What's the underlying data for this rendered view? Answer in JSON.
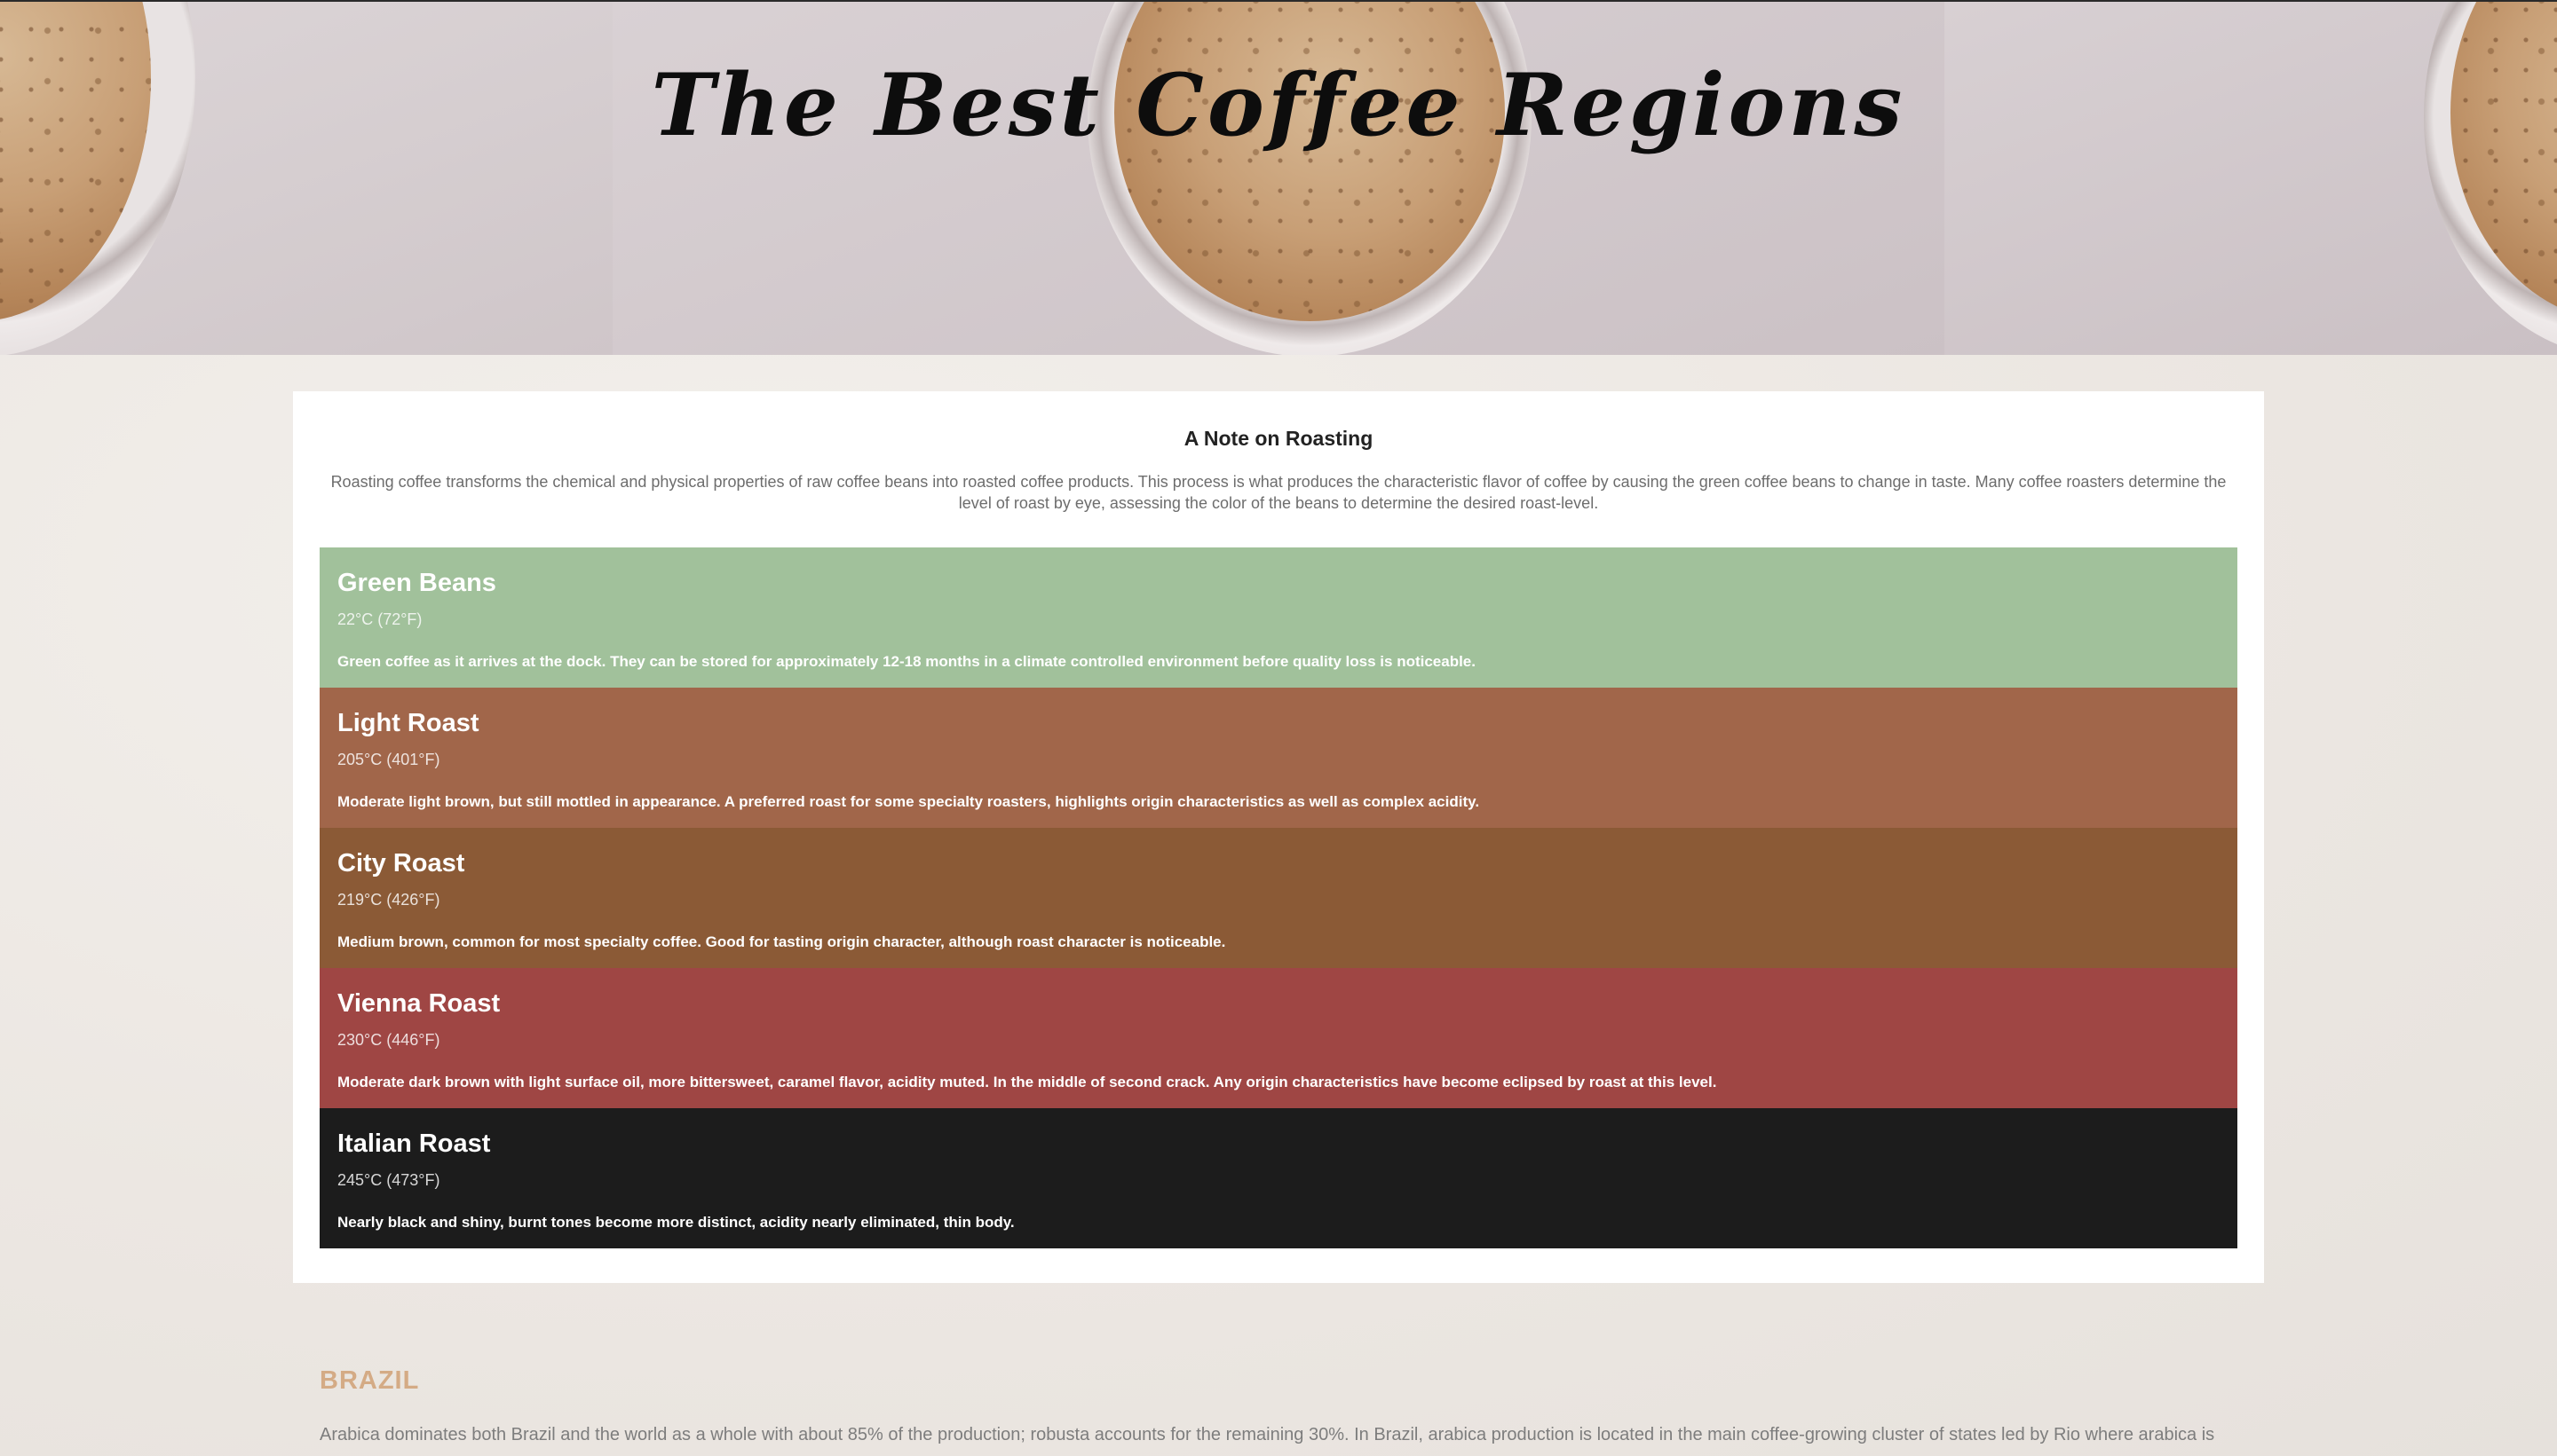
{
  "hero": {
    "title": "The Best Coffee Regions"
  },
  "roasting": {
    "heading": "A Note on Roasting",
    "intro": "Roasting coffee transforms the chemical and physical properties of raw coffee beans into roasted coffee products. This process is what produces the characteristic flavor of coffee by causing the green coffee beans to change in taste. Many coffee roasters determine the level of roast by eye, assessing the color of the beans to determine the desired roast-level.",
    "levels": [
      {
        "name": "Green Beans",
        "temp": "22°C (72°F)",
        "desc": "Green coffee as it arrives at the dock. They can be stored for approximately 12-18 months in a climate controlled environment before quality loss is noticeable.",
        "color": "#a1c19b"
      },
      {
        "name": "Light Roast",
        "temp": "205°C (401°F)",
        "desc": "Moderate light brown, but still mottled in appearance. A preferred roast for some specialty roasters, highlights origin characteristics as well as complex acidity.",
        "color": "#a1664a"
      },
      {
        "name": "City Roast",
        "temp": "219°C (426°F)",
        "desc": "Medium brown, common for most specialty coffee. Good for tasting origin character, although roast character is noticeable.",
        "color": "#8b5a36"
      },
      {
        "name": "Vienna Roast",
        "temp": "230°C (446°F)",
        "desc": "Moderate dark brown with light surface oil, more bittersweet, caramel flavor, acidity muted. In the middle of second crack. Any origin characteristics have become eclipsed by roast at this level.",
        "color": "#9f4644"
      },
      {
        "name": "Italian Roast",
        "temp": "245°C (473°F)",
        "desc": "Nearly black and shiny, burnt tones become more distinct, acidity nearly eliminated, thin body.",
        "color": "#1c1c1c"
      }
    ]
  },
  "brazil": {
    "title": "BRAZIL",
    "text": "Arabica dominates both Brazil and the world as a whole with about 85% of the production; robusta accounts for the remaining 30%. In Brazil, arabica production is located in the main coffee-growing cluster of states led by Rio where arabica is"
  }
}
